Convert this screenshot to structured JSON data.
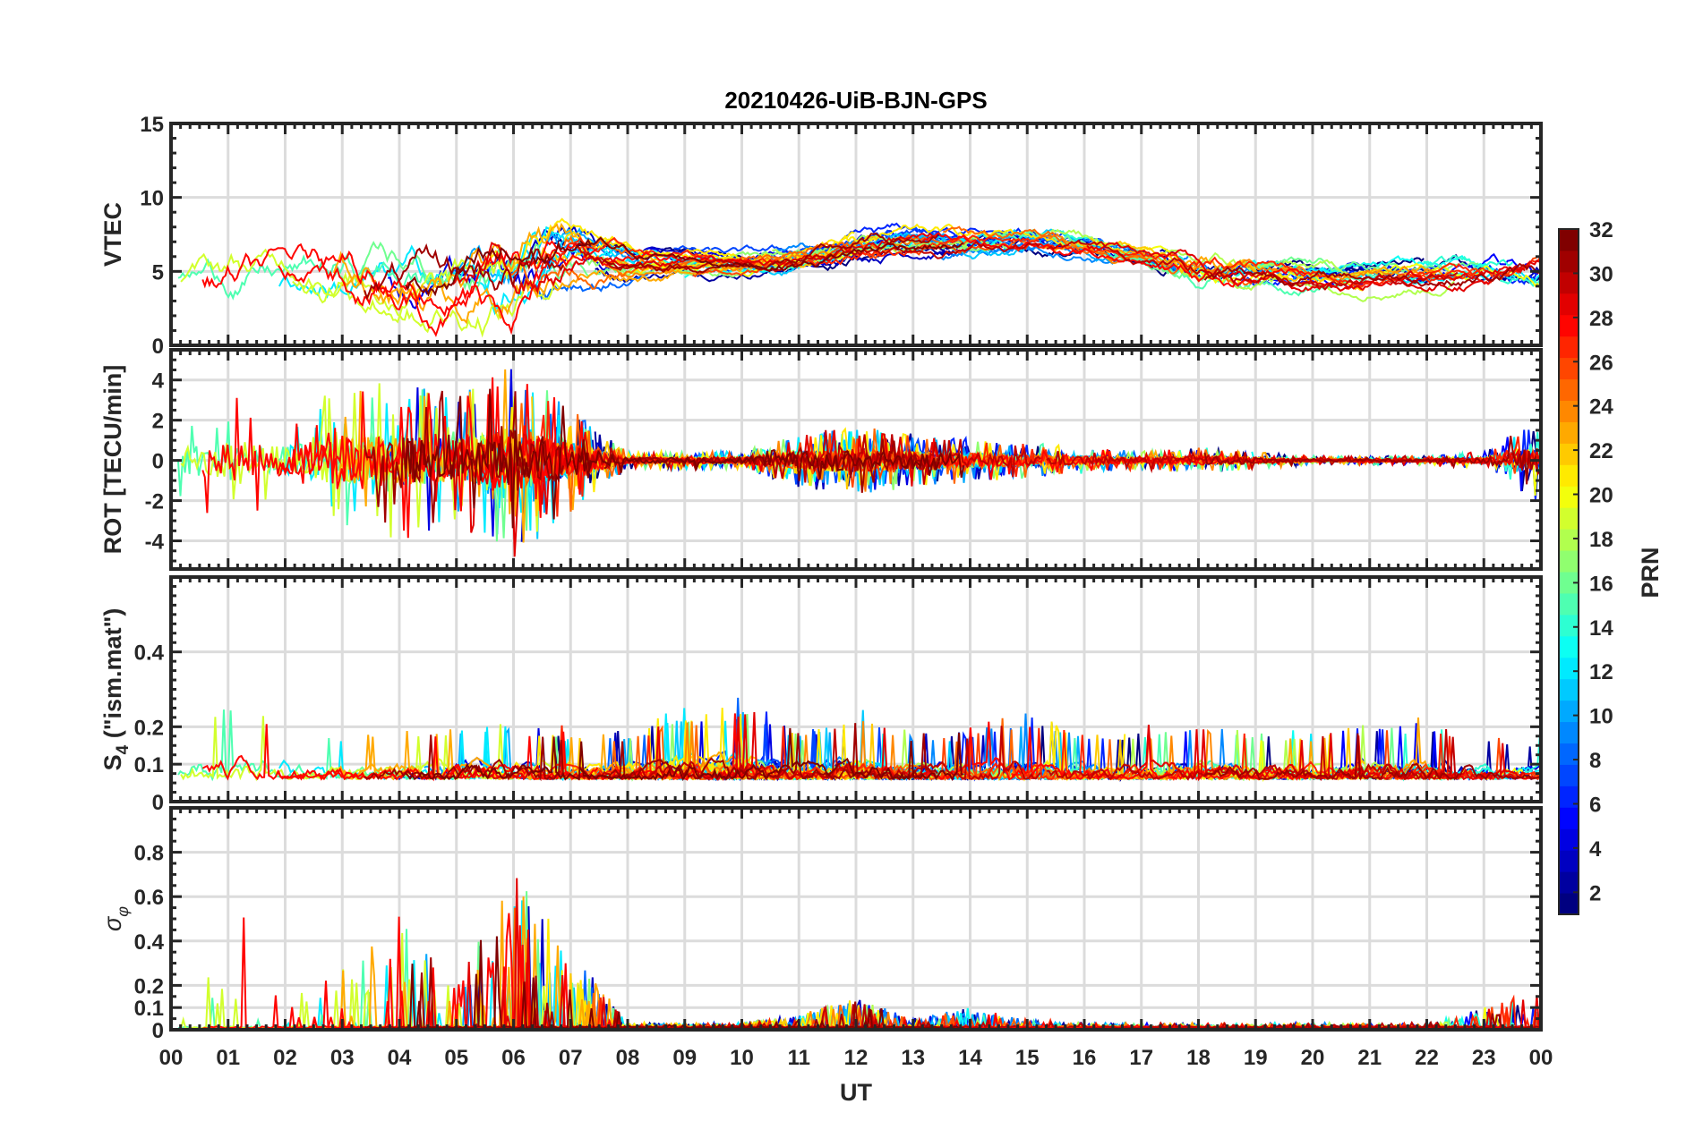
{
  "chart_data": {
    "type": "line",
    "title": "20210426-UiB-BJN-GPS",
    "xlabel": "UT",
    "x_tick_labels": [
      "00",
      "01",
      "02",
      "03",
      "04",
      "05",
      "06",
      "07",
      "08",
      "09",
      "10",
      "11",
      "12",
      "13",
      "14",
      "15",
      "16",
      "17",
      "18",
      "19",
      "20",
      "21",
      "22",
      "23",
      "00"
    ],
    "xlim_hours": [
      0,
      24
    ],
    "grid": true,
    "colormap": "jet",
    "colorbar": {
      "label": "PRN",
      "range": [
        1,
        32
      ],
      "tick_labels": [
        "2",
        "4",
        "6",
        "8",
        "10",
        "12",
        "14",
        "16",
        "18",
        "20",
        "22",
        "24",
        "26",
        "28",
        "30",
        "32"
      ],
      "placement": "right"
    },
    "series_note_hours": [
      0,
      1,
      2,
      3,
      4,
      5,
      6,
      7,
      8,
      9,
      10,
      11,
      12,
      13,
      14,
      15,
      16,
      17,
      18,
      19,
      20,
      21,
      22,
      23,
      24
    ],
    "panels": [
      {
        "id": "vtec",
        "ylabel": "VTEC",
        "ylim": [
          0,
          15
        ],
        "ytick_labels": [
          "0",
          "5",
          "10",
          "15"
        ],
        "yticks": [
          0,
          5,
          10,
          15
        ],
        "typical_hourly": [
          4.5,
          5,
          5,
          4.8,
          4.5,
          4,
          4.5,
          6,
          5.5,
          5.5,
          5.5,
          5.8,
          6.5,
          7,
          7,
          7.2,
          6.8,
          6,
          5.2,
          5,
          4.8,
          4.8,
          4.8,
          5,
          5
        ],
        "variability_hourly": [
          0.8,
          1.5,
          1,
          1.5,
          1.5,
          1.5,
          2,
          1,
          0.5,
          0.4,
          0.4,
          0.5,
          0.6,
          0.5,
          0.5,
          0.5,
          0.5,
          0.4,
          0.8,
          0.6,
          0.5,
          0.5,
          0.5,
          0.6,
          0.8
        ]
      },
      {
        "id": "rot",
        "ylabel": "ROT [TECU/min]",
        "ylim": [
          -5.4,
          5.5
        ],
        "ytick_labels": [
          "-4",
          "-2",
          "0",
          "2",
          "4"
        ],
        "yticks": [
          -4,
          -2,
          0,
          2,
          4
        ],
        "typical_hourly": [
          0,
          0,
          0,
          0,
          0,
          0,
          0,
          0,
          0,
          0,
          0,
          0,
          0,
          0,
          0,
          0,
          0,
          0,
          0,
          0,
          0,
          0,
          0,
          0,
          0
        ],
        "variability_hourly": [
          0.8,
          1.5,
          1,
          1.8,
          1.8,
          1.5,
          2.2,
          1.2,
          0.2,
          0.2,
          0.2,
          0.6,
          0.8,
          0.6,
          0.5,
          0.4,
          0.3,
          0.2,
          0.3,
          0.2,
          0.1,
          0.1,
          0.1,
          0.2,
          1
        ]
      },
      {
        "id": "s4",
        "ylabel": "S4 (\"ism.mat\")",
        "ylabel_main": "S",
        "ylabel_sub": "4",
        "ylabel_rest": " (\"ism.mat\")",
        "ylim": [
          0,
          0.6
        ],
        "ytick_labels": [
          "0",
          "0.1",
          "0.2",
          "0.4"
        ],
        "yticks": [
          0,
          0.1,
          0.2,
          0.4
        ],
        "typical_hourly": [
          0.07,
          0.07,
          0.07,
          0.07,
          0.07,
          0.07,
          0.07,
          0.07,
          0.07,
          0.07,
          0.07,
          0.07,
          0.07,
          0.07,
          0.07,
          0.07,
          0.07,
          0.07,
          0.07,
          0.07,
          0.07,
          0.07,
          0.07,
          0.07,
          0.07
        ],
        "variability_hourly": [
          0.08,
          0.08,
          0.06,
          0.05,
          0.05,
          0.06,
          0.06,
          0.05,
          0.05,
          0.07,
          0.08,
          0.05,
          0.07,
          0.05,
          0.05,
          0.07,
          0.05,
          0.05,
          0.06,
          0.05,
          0.05,
          0.06,
          0.06,
          0.05,
          0.04
        ]
      },
      {
        "id": "sigma",
        "ylabel": "σφ",
        "ylabel_main": "σ",
        "ylabel_sub": "φ",
        "ylim": [
          0,
          1.0
        ],
        "ytick_labels": [
          "0",
          "0.1",
          "0.2",
          "0.4",
          "0.6",
          "0.8"
        ],
        "yticks": [
          0,
          0.1,
          0.2,
          0.4,
          0.6,
          0.8
        ],
        "typical_hourly": [
          0.01,
          0.01,
          0.01,
          0.01,
          0.01,
          0.01,
          0.01,
          0.01,
          0.01,
          0.01,
          0.01,
          0.01,
          0.01,
          0.01,
          0.01,
          0.01,
          0.01,
          0.01,
          0.01,
          0.01,
          0.01,
          0.01,
          0.01,
          0.01,
          0.01
        ],
        "variability_hourly": [
          0.05,
          0.4,
          0.06,
          0.15,
          0.3,
          0.1,
          0.4,
          0.2,
          0.01,
          0.01,
          0.01,
          0.03,
          0.08,
          0.02,
          0.05,
          0.02,
          0.01,
          0.01,
          0.01,
          0.01,
          0.01,
          0.01,
          0.01,
          0.05,
          0.1
        ]
      }
    ]
  }
}
